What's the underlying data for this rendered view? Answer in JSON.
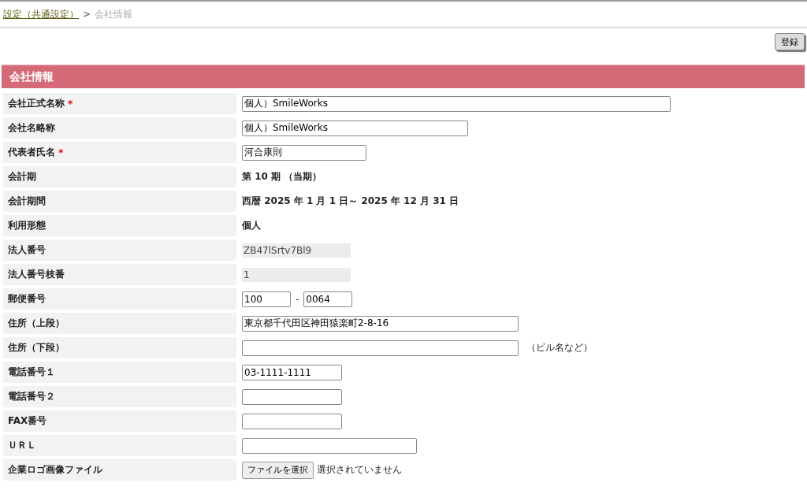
{
  "breadcrumb": {
    "link": "設定（共通設定）",
    "separator": ">",
    "current": "会社情報"
  },
  "register_button": "登録",
  "section": {
    "title": "会社情報"
  },
  "rows": [
    {
      "label": "会社正式名称",
      "required_mark": "*",
      "kind": "input",
      "value": "個人）SmileWorks"
    },
    {
      "label": "会社名略称",
      "kind": "input",
      "value": "個人）SmileWorks"
    },
    {
      "label": "代表者氏名",
      "required_mark": "*",
      "kind": "input",
      "value": "河合康則"
    },
    {
      "label": "会計期",
      "kind": "text",
      "value": "第 10 期 （当期）"
    },
    {
      "label": "会計期間",
      "kind": "text",
      "value": "西暦 2025 年 1 月 1 日～ 2025 年 12 月 31 日"
    },
    {
      "label": "利用形態",
      "kind": "text",
      "value": " 個人"
    },
    {
      "label": "法人番号",
      "kind": "readonly",
      "value": "ZB47lSrtv7Bl9"
    },
    {
      "label": "法人番号枝番",
      "kind": "readonly",
      "value": "1"
    },
    {
      "label": "郵便番号",
      "kind": "postal",
      "value": "100",
      "separator": "-",
      "value2": "0064"
    },
    {
      "label": "住所（上段）",
      "kind": "input",
      "value": "東京都千代田区神田猿楽町2-8-16"
    },
    {
      "label": "住所（下段）",
      "kind": "input",
      "value": "",
      "note": "（ビル名など）"
    },
    {
      "label": "電話番号１",
      "kind": "input",
      "value": "03-1111-1111"
    },
    {
      "label": "電話番号２",
      "kind": "input",
      "value": ""
    },
    {
      "label": "FAX番号",
      "kind": "input",
      "value": ""
    },
    {
      "label": "ＵＲＬ",
      "kind": "input",
      "value": ""
    },
    {
      "label": "企業ロゴ画像ファイル",
      "kind": "file",
      "button": "ファイルを選択",
      "status": "選択されていません"
    }
  ]
}
